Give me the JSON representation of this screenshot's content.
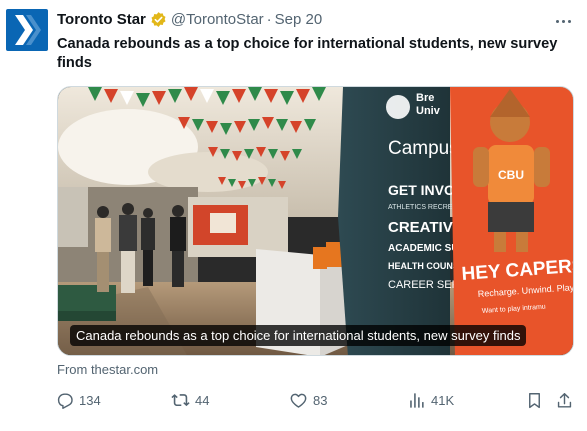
{
  "tweet": {
    "author_name": "Toronto Star",
    "handle": "@TorontoStar",
    "separator": "·",
    "time": "Sep 20",
    "text": "Canada rebounds as a top choice for international students, new survey finds",
    "verified_icon": "verified-gold-badge-icon",
    "avatar_icon": "toronto-star-logo-icon"
  },
  "media": {
    "caption": "Canada rebounds as a top choice for international students, new survey finds",
    "source": "From thestar.com",
    "banner_texts": {
      "campus_sign_top": "Bre",
      "campus_sign_top2": "Univ",
      "campus": "Campus",
      "get_involved": "GET INVOL",
      "athletics": "ATHLETICS  RECRE",
      "creative": "CREATIVE A",
      "academic": "ACADEMIC SUPP",
      "health": "HEALTH  COUNSE",
      "career": "CAREER SERVI",
      "mascot_shirt": "CBU",
      "hey_capers": "HEY CAPERS!",
      "tagline": "Recharge. Unwind. Play.",
      "small_text": "Want to play intramu"
    }
  },
  "actions": {
    "reply": {
      "icon": "reply-icon",
      "count": "134"
    },
    "retweet": {
      "icon": "retweet-icon",
      "count": "44"
    },
    "like": {
      "icon": "heart-icon",
      "count": "83"
    },
    "views": {
      "icon": "views-chart-icon",
      "count": "41K"
    },
    "bookmark": {
      "icon": "bookmark-icon"
    },
    "share": {
      "icon": "share-icon"
    }
  },
  "colors": {
    "text_primary": "#0f1419",
    "text_secondary": "#536471",
    "avatar_blue": "#0a66b4",
    "verified_gold": "#e2b719",
    "banner_orange": "#e8542a"
  }
}
